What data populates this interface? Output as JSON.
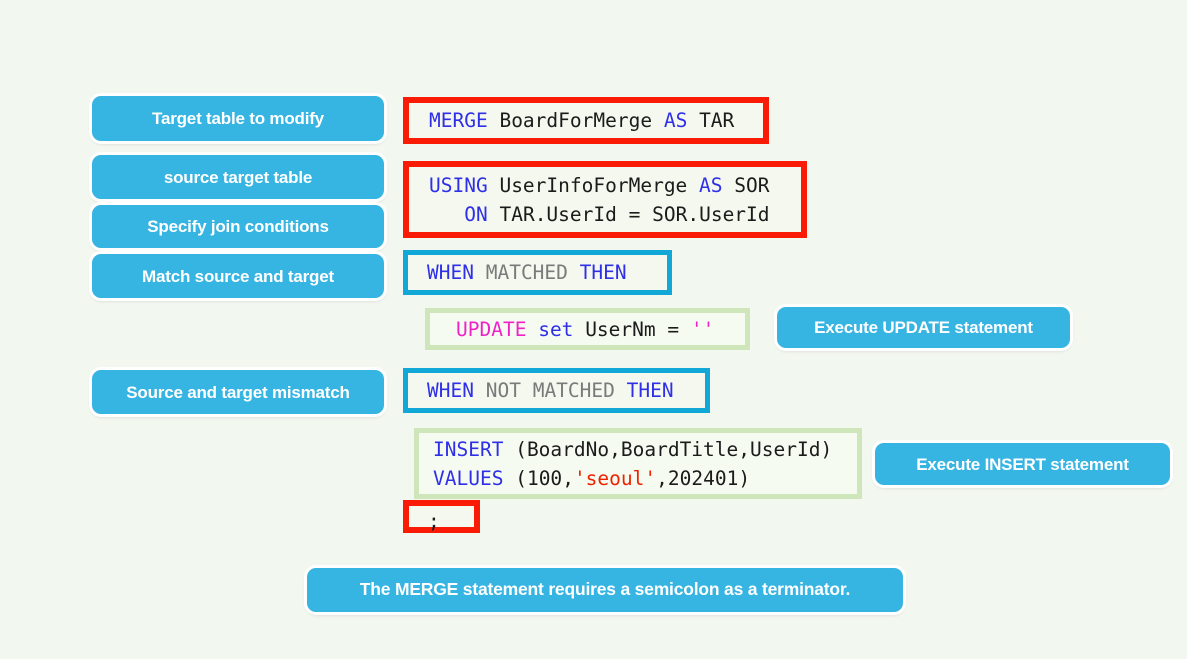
{
  "colors": {
    "background": "#f2f7ef",
    "label_blue": "#36b4e2",
    "highlight_red": "#f91b05",
    "highlight_cyan": "#11a8d7",
    "highlight_green": "#cfe6bb",
    "keyword_blue": "#2f2fe8",
    "keyword_gray": "#7a7a7a",
    "keyword_magenta": "#ef22c8",
    "string_red": "#ee2200"
  },
  "labels": {
    "target_table": "Target table to modify",
    "source_table": "source target table",
    "join_conditions": "Specify join conditions",
    "match_source_target": "Match source and target",
    "source_target_mismatch": "Source and target mismatch",
    "execute_update": "Execute UPDATE statement",
    "execute_insert": "Execute INSERT statement",
    "footer_note": "The MERGE statement requires a semicolon as a terminator."
  },
  "code": {
    "merge": {
      "keyword": "MERGE",
      "table": "BoardForMerge",
      "as": "AS",
      "alias": "TAR",
      "text": "MERGE BoardForMerge AS TAR"
    },
    "using": {
      "keyword": "USING",
      "table": "UserInfoForMerge",
      "as": "AS",
      "alias": "SOR",
      "on_keyword": "ON",
      "on_left": "TAR.UserId",
      "equals": "=",
      "on_right": "SOR.UserId",
      "line1": "USING UserInfoForMerge AS SOR",
      "line2": "   ON TAR.UserId = SOR.UserId"
    },
    "when_matched": {
      "when": "WHEN",
      "matched": "MATCHED",
      "then": "THEN",
      "text": "WHEN MATCHED THEN"
    },
    "update": {
      "keyword": "UPDATE",
      "set": "set",
      "column": "UserNm",
      "equals": "=",
      "value": "''",
      "text": "UPDATE set UserNm = ''"
    },
    "when_not_matched": {
      "when": "WHEN",
      "not": "NOT",
      "matched": "MATCHED",
      "then": "THEN",
      "text": "WHEN NOT MATCHED THEN"
    },
    "insert": {
      "keyword": "INSERT",
      "columns": "(BoardNo,BoardTitle,UserId)",
      "values_keyword": "VALUES",
      "values_open": "(",
      "value_num1": "100",
      "comma1": ",",
      "value_str": "'seoul'",
      "comma2": ",",
      "value_num2": "202401",
      "values_close": ")",
      "line1": "INSERT (BoardNo,BoardTitle,UserId)",
      "line2": "VALUES (100,'seoul',202401)"
    },
    "terminator": {
      "text": ";"
    }
  }
}
